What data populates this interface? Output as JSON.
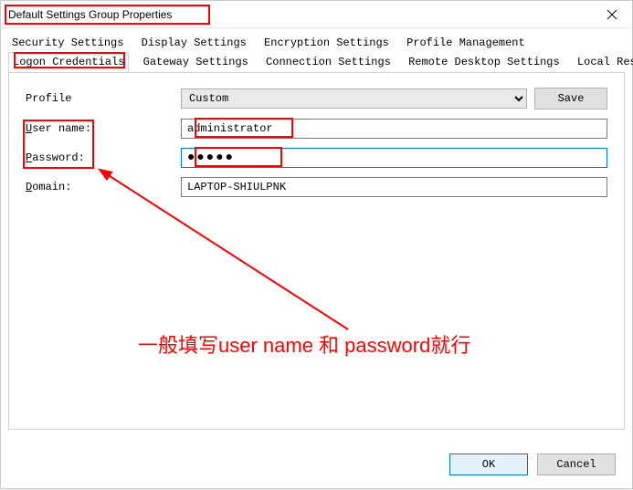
{
  "window": {
    "title": "Default Settings Group Properties"
  },
  "tabs": {
    "row1": [
      {
        "label": "Security Settings",
        "active": false
      },
      {
        "label": "Display Settings",
        "active": false
      },
      {
        "label": "Encryption Settings",
        "active": false
      },
      {
        "label": "Profile Management",
        "active": false
      }
    ],
    "row2": [
      {
        "label": "Logon Credentials",
        "active": true
      },
      {
        "label": "Gateway Settings",
        "active": false
      },
      {
        "label": "Connection Settings",
        "active": false
      },
      {
        "label": "Remote Desktop Settings",
        "active": false
      },
      {
        "label": "Local Resources",
        "active": false
      }
    ]
  },
  "form": {
    "profile_label": "Profile",
    "profile_value": "Custom",
    "save_label": "Save",
    "username_label_pre": "U",
    "username_label_post": "ser name:",
    "username_value": "administrator",
    "password_label_pre": "P",
    "password_label_post": "assword:",
    "password_mask": "●●●●●",
    "domain_label_pre": "D",
    "domain_label_post": "omain:",
    "domain_value": "LAPTOP-SHIULPNK"
  },
  "buttons": {
    "ok": "OK",
    "cancel": "Cancel"
  },
  "annotation": {
    "text": "一般填写user name 和 password就行"
  }
}
